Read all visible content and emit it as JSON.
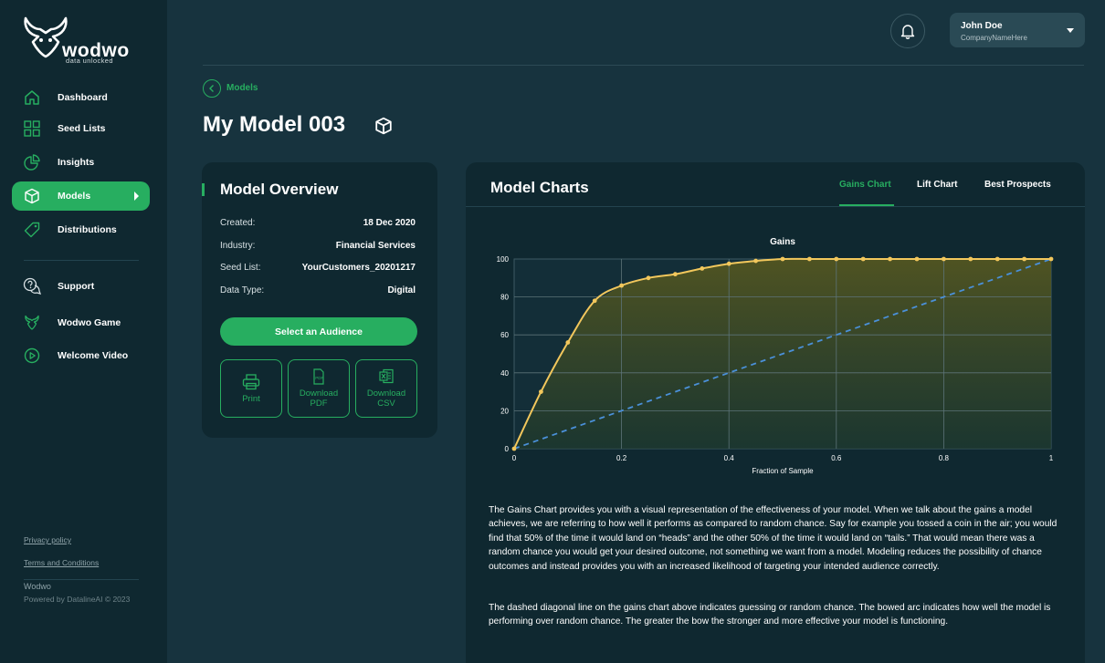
{
  "brand": {
    "name": "wodwo",
    "tagline": "data unlocked"
  },
  "sidebar": {
    "items": [
      {
        "label": "Dashboard",
        "icon": "home-icon"
      },
      {
        "label": "Seed Lists",
        "icon": "grid-icon"
      },
      {
        "label": "Insights",
        "icon": "pie-chart-icon"
      },
      {
        "label": "Models",
        "icon": "cube-icon",
        "active": true
      },
      {
        "label": "Distributions",
        "icon": "tag-icon"
      },
      {
        "label": "Support",
        "icon": "chat-help-icon"
      },
      {
        "label": "Wodwo Game",
        "icon": "wodwo-head-icon"
      },
      {
        "label": "Welcome Video",
        "icon": "play-circle-icon"
      }
    ],
    "privacy": "Privacy policy",
    "terms": "Terms and Conditions",
    "footer_brand": "Wodwo",
    "copyright": "Powered by DatalineAI © 2023"
  },
  "user": {
    "name": "John Doe",
    "company": "CompanyNameHere"
  },
  "breadcrumb": {
    "label": "Models"
  },
  "page": {
    "title": "My Model 003"
  },
  "overview": {
    "title": "Model Overview",
    "rows": [
      {
        "key": "Created:",
        "value": "18 Dec 2020"
      },
      {
        "key": "Industry:",
        "value": "Financial Services"
      },
      {
        "key": "Seed List:",
        "value": "YourCustomers_20201217"
      },
      {
        "key": "Data Type:",
        "value": "Digital"
      }
    ],
    "select_button": "Select an Audience",
    "print": "Print",
    "download_pdf_1": "Download",
    "download_pdf_2": "PDF",
    "download_csv_1": "Download",
    "download_csv_2": "CSV"
  },
  "charts": {
    "title": "Model Charts",
    "tabs": [
      "Gains Chart",
      "Lift Chart",
      "Best Prospects"
    ],
    "description_1": "The Gains Chart provides you with a visual representation of the effectiveness of your model.  When we talk about the gains a model achieves, we are referring to how well it performs as compared to random chance.  Say for example you tossed a coin in the air; you would find that 50% of the time it would land on “heads” and the other 50% of the time it would land on “tails.”  That would mean there was a random chance you would get your desired outcome, not something we want from a model.  Modeling reduces the possibility of chance outcomes and instead provides you with an increased likelihood of targeting your intended audience correctly.",
    "description_2": "The dashed diagonal line on the gains chart above indicates guessing or random chance.  The bowed arc indicates how well the model is performing over random chance.  The greater the bow the stronger and more effective your model is functioning."
  },
  "chart_data": {
    "type": "line",
    "title": "Gains",
    "xlabel": "Fraction of Sample",
    "ylabel": "",
    "xlim": [
      0,
      1
    ],
    "ylim": [
      0,
      100
    ],
    "xticks": [
      "0",
      "0.2",
      "0.4",
      "0.6",
      "0.8",
      "1"
    ],
    "yticks": [
      "0",
      "20",
      "40",
      "60",
      "80",
      "100"
    ],
    "grid": true,
    "x": [
      0,
      0.05,
      0.1,
      0.15,
      0.2,
      0.25,
      0.3,
      0.35,
      0.4,
      0.45,
      0.5,
      0.55,
      0.6,
      0.65,
      0.7,
      0.75,
      0.8,
      0.85,
      0.9,
      0.95,
      1.0
    ],
    "series": [
      {
        "values": [
          0,
          30,
          56,
          78,
          86,
          90,
          92,
          95,
          97.5,
          99,
          100,
          100,
          100,
          100,
          100,
          100,
          100,
          100,
          100,
          100,
          100
        ],
        "color": "#f2c75c",
        "style": "solid"
      },
      {
        "values": [
          0,
          5,
          10,
          15,
          20,
          25,
          30,
          35,
          40,
          45,
          50,
          55,
          60,
          65,
          70,
          75,
          80,
          85,
          90,
          95,
          100
        ],
        "color": "#4a90d9",
        "style": "dashed"
      }
    ]
  }
}
